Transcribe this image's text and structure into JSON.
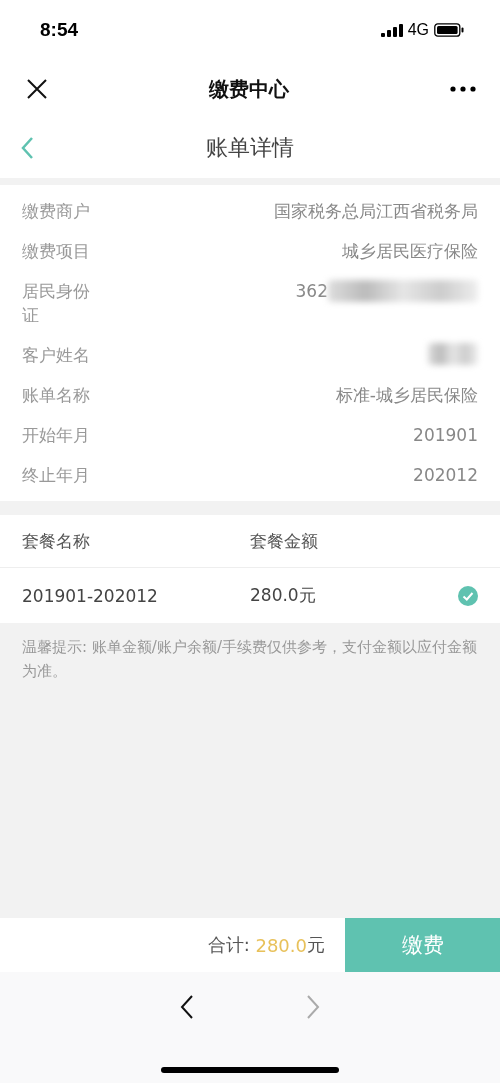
{
  "status_bar": {
    "time": "8:54",
    "network": "4G"
  },
  "nav_bar": {
    "title": "缴费中心"
  },
  "sub_header": {
    "title": "账单详情"
  },
  "details": [
    {
      "label": "缴费商户",
      "value": "国家税务总局江西省税务局",
      "redacted": false
    },
    {
      "label": "缴费项目",
      "value": "城乡居民医疗保险",
      "redacted": false
    },
    {
      "label": "居民身份证",
      "value": "362",
      "redacted": true
    },
    {
      "label": "客户姓名",
      "redacted": true
    },
    {
      "label": "账单名称",
      "value": "标准-城乡居民保险",
      "redacted": false
    },
    {
      "label": "开始年月",
      "value": "201901",
      "redacted": false
    },
    {
      "label": "终止年月",
      "value": "202012",
      "redacted": false
    }
  ],
  "packages": {
    "columns": [
      "套餐名称",
      "套餐金额"
    ],
    "rows": [
      {
        "name": "201901-202012",
        "amount": "280.0元",
        "selected": true
      }
    ]
  },
  "tip": "温馨提示: 账单金额/账户余额/手续费仅供参考，支付金额以应付金额为准。",
  "footer": {
    "total_label": "合计:",
    "total_amount": "280.0",
    "total_unit": "元",
    "pay_button": "缴费"
  },
  "browser_nav": {
    "back_disabled": false,
    "forward_disabled": true
  }
}
